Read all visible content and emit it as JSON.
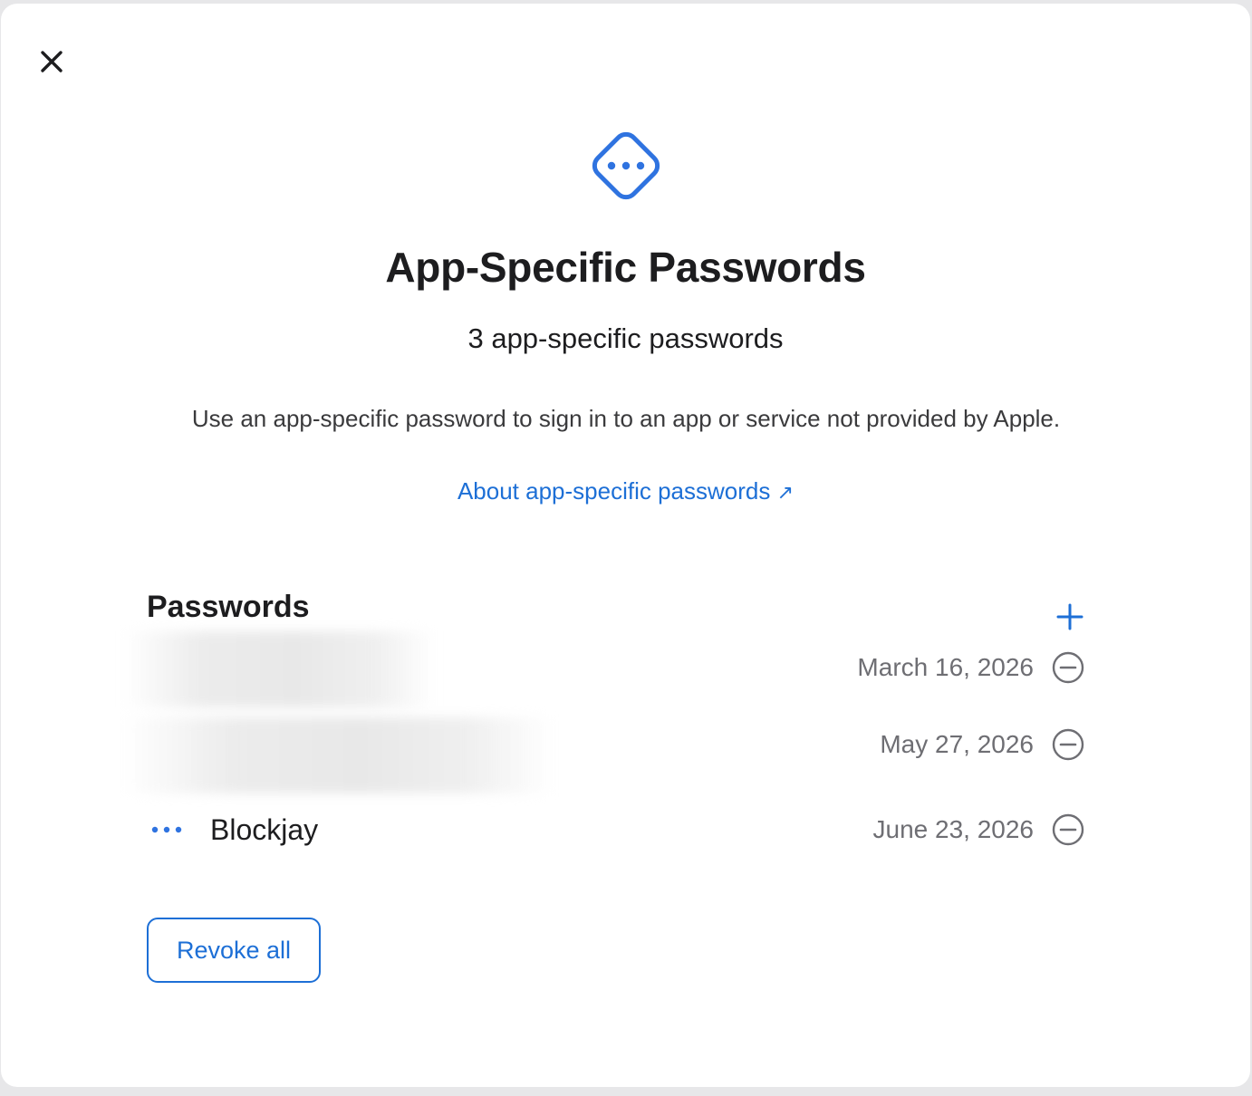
{
  "dialog": {
    "close_icon": "close-icon",
    "hero_icon": "ellipsis-diamond-icon",
    "title": "App-Specific Passwords",
    "subtitle": "3 app-specific passwords",
    "description": "Use an app-specific password to sign in to an app or service not provided by Apple.",
    "about_link": "About app-specific passwords",
    "about_link_icon": "↗"
  },
  "passwords": {
    "section_title": "Passwords",
    "add_icon": "plus-icon",
    "items": [
      {
        "name": "",
        "name_blurred": true,
        "date": "March 16, 2026",
        "remove_icon": "minus-circle-icon"
      },
      {
        "name": "",
        "name_blurred": true,
        "date": "May 27, 2026",
        "remove_icon": "minus-circle-icon"
      },
      {
        "name": "Blockjay",
        "name_blurred": false,
        "icon": "ellipsis-icon",
        "date": "June 23, 2026",
        "remove_icon": "minus-circle-icon"
      }
    ]
  },
  "footer": {
    "revoke_all_label": "Revoke all"
  },
  "colors": {
    "accent": "#1d6fd6",
    "text_primary": "#1d1d1f",
    "text_secondary": "#6e6e73",
    "background": "#ffffff"
  }
}
